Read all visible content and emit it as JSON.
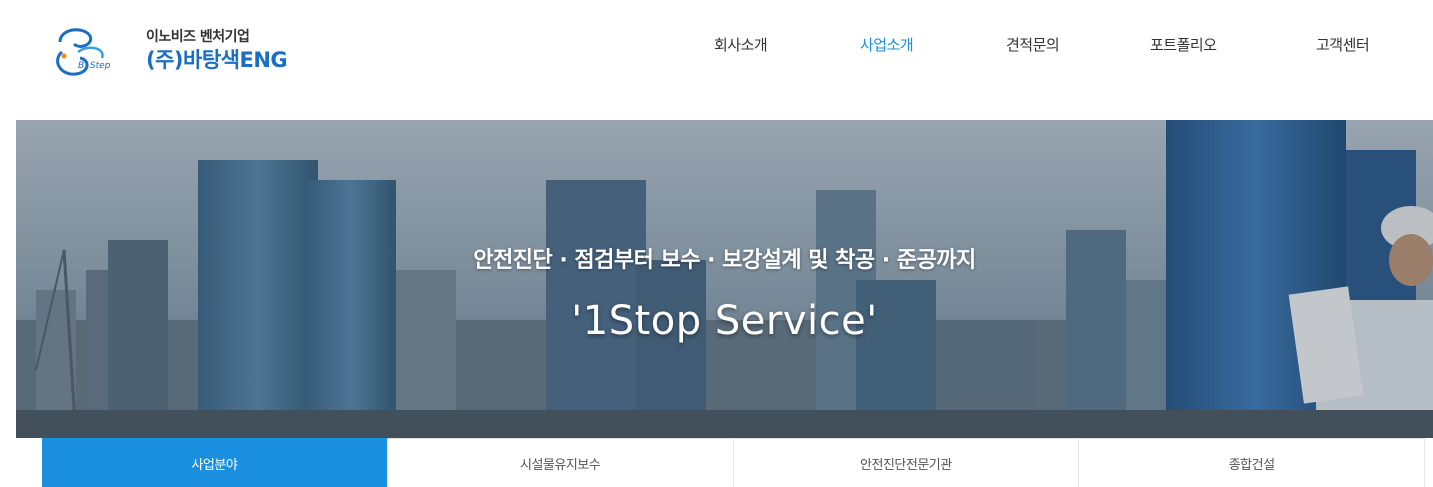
{
  "header": {
    "logo": {
      "sub_text": "이노비즈 벤처기업",
      "main_text": "(주)바탕색ENG",
      "mark_text": "B1Step"
    },
    "nav": [
      {
        "label": "회사소개",
        "active": false
      },
      {
        "label": "사업소개",
        "active": true
      },
      {
        "label": "견적문의",
        "active": false
      },
      {
        "label": "포트폴리오",
        "active": false
      },
      {
        "label": "고객센터",
        "active": false
      }
    ]
  },
  "hero": {
    "subtitle": "안전진단 · 점검부터 보수 · 보강설계 및 착공 · 준공까지",
    "title": "'1Stop Service'"
  },
  "tabs": [
    {
      "label": "사업분야",
      "active": true
    },
    {
      "label": "시설물유지보수",
      "active": false
    },
    {
      "label": "안전진단전문기관",
      "active": false
    },
    {
      "label": "종합건설",
      "active": false
    }
  ],
  "colors": {
    "accent": "#1a8fe0",
    "logo_blue": "#1a6fc4"
  }
}
